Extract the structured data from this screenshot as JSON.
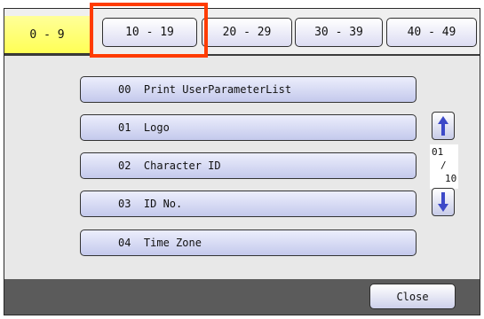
{
  "tabs": [
    {
      "label": "0 - 9",
      "active": true
    },
    {
      "label": "10 - 19",
      "active": false
    },
    {
      "label": "20 - 29",
      "active": false
    },
    {
      "label": "30 - 39",
      "active": false
    },
    {
      "label": "40 - 49",
      "active": false
    }
  ],
  "list": [
    {
      "label": "00  Print UserParameterList"
    },
    {
      "label": "01  Logo"
    },
    {
      "label": "02  Character ID"
    },
    {
      "label": "03  ID No."
    },
    {
      "label": "04  Time Zone"
    }
  ],
  "pager": {
    "current": "01",
    "separator": "/",
    "total": "10",
    "up_icon": "arrow-up-icon",
    "down_icon": "arrow-down-icon"
  },
  "footer": {
    "close_label": "Close"
  },
  "colors": {
    "active_tab": "#ffff66",
    "highlight": "#ff3c00",
    "bottom_bar": "#5b5b5b",
    "arrow": "#3c49c8"
  }
}
